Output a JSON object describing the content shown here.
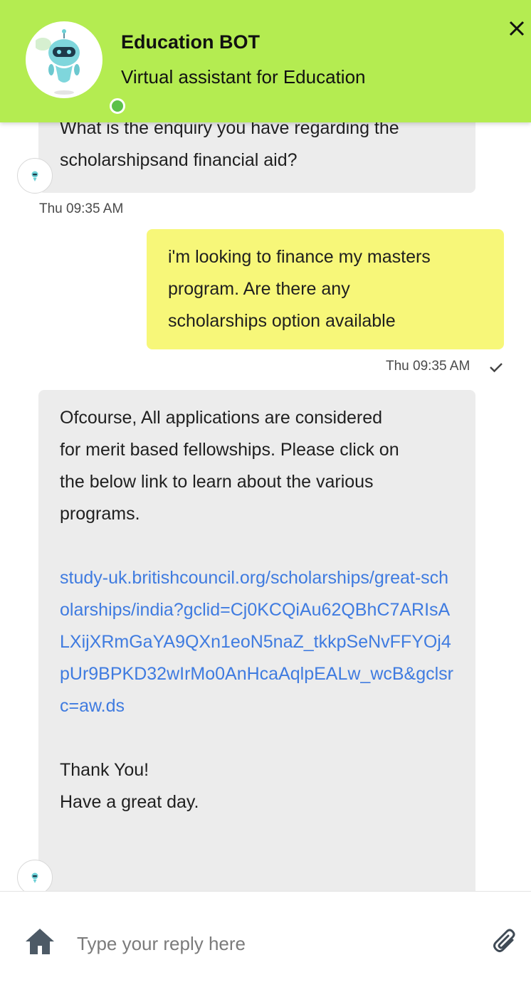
{
  "header": {
    "title": "Education BOT",
    "subtitle": "Virtual assistant for Education",
    "close_icon": "close-icon",
    "online_color": "#5cc14a",
    "background": "#b4ec51"
  },
  "messages": [
    {
      "sender": "bot",
      "lines": [
        "What is the enquiry you have regarding the",
        "scholarshipsand financial aid?"
      ],
      "timestamp": "Thu 09:35 AM"
    },
    {
      "sender": "user",
      "lines": [
        "i'm looking to finance my masters",
        "program. Are there any",
        "scholarships option available"
      ],
      "timestamp": "Thu 09:35 AM",
      "status_icon": "checkmark-icon"
    },
    {
      "sender": "bot",
      "intro_lines": [
        "Ofcourse, All applications are considered",
        "for merit based fellowships. Please click on",
        "the below link to learn about the various",
        "programs."
      ],
      "link": "study-uk.britishcouncil.org/scholarships/great-scholarships/india?gclid=Cj0KCQiAu62QBhC7ARIsALXijXRmGaYA9QXn1eoN5naZ_tkkpSeNvFFYOj4pUr9BPKD32wIrMo0AnHcaAqlpEALw_wcB&gclsrc=aw.ds",
      "outro_lines": [
        "Thank You!",
        "Have a great day."
      ]
    }
  ],
  "composer": {
    "placeholder": "Type your reply here",
    "home_icon": "home-icon",
    "attach_icon": "paperclip-icon"
  }
}
